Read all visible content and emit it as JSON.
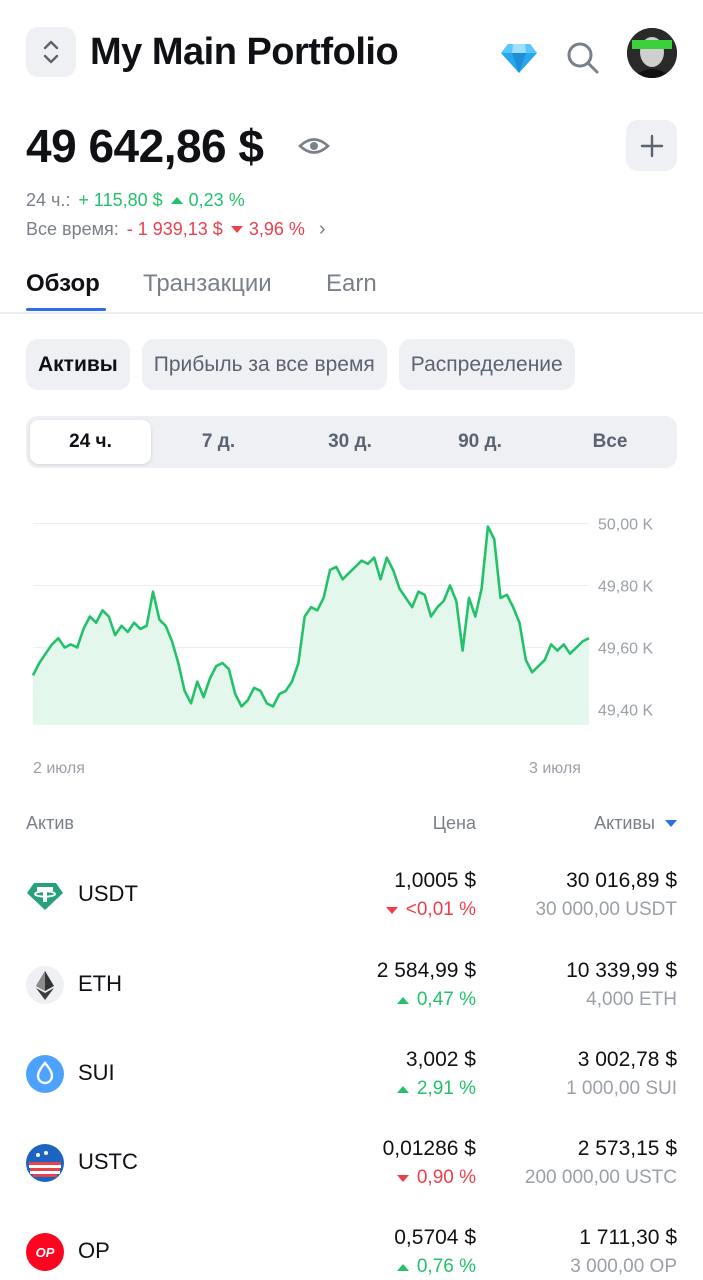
{
  "header": {
    "title": "My Main Portfolio",
    "icons": [
      "switch-portfolio-icon",
      "diamond-icon",
      "search-icon",
      "avatar"
    ]
  },
  "balance": {
    "total": "49 642,86 $",
    "pnl_24h_label": "24 ч.:",
    "pnl_24h_value": "+ 115,80 $",
    "pnl_24h_pct": "0,23 %",
    "pnl_all_label": "Все время:",
    "pnl_all_value": "- 1 939,13 $",
    "pnl_all_pct": "3,96 %"
  },
  "tabs": [
    "Обзор",
    "Транзакции",
    "Earn"
  ],
  "chips": [
    "Активы",
    "Прибыль за все время",
    "Распределение"
  ],
  "periods": [
    "24 ч.",
    "7 д.",
    "30 д.",
    "90 д.",
    "Все"
  ],
  "chart_data": {
    "type": "area",
    "x_labels": [
      "2 июля",
      "3 июля"
    ],
    "y_ticks": [
      "50,00 K",
      "49,80 K",
      "49,60 K",
      "49,40 K"
    ],
    "ylim": [
      49.35,
      50.05
    ],
    "y_unit": "K",
    "values": [
      49.51,
      49.55,
      49.58,
      49.61,
      49.63,
      49.6,
      49.61,
      49.6,
      49.66,
      49.7,
      49.68,
      49.72,
      49.7,
      49.64,
      49.67,
      49.65,
      49.68,
      49.66,
      49.67,
      49.78,
      49.69,
      49.67,
      49.62,
      49.55,
      49.46,
      49.42,
      49.49,
      49.44,
      49.5,
      49.54,
      49.55,
      49.53,
      49.45,
      49.41,
      49.43,
      49.47,
      49.46,
      49.42,
      49.41,
      49.45,
      49.46,
      49.49,
      49.55,
      49.7,
      49.73,
      49.72,
      49.76,
      49.85,
      49.86,
      49.82,
      49.84,
      49.86,
      49.88,
      49.87,
      49.89,
      49.82,
      49.89,
      49.85,
      49.79,
      49.76,
      49.73,
      49.78,
      49.77,
      49.7,
      49.73,
      49.75,
      49.8,
      49.75,
      49.59,
      49.76,
      49.7,
      49.79,
      49.99,
      49.95,
      49.76,
      49.77,
      49.73,
      49.68,
      49.56,
      49.52,
      49.54,
      49.56,
      49.61,
      49.59,
      49.61,
      49.58,
      49.6,
      49.62,
      49.63
    ],
    "color": "#23c26a",
    "fill": "#e4f7ec"
  },
  "table": {
    "headers": {
      "asset": "Актив",
      "price": "Цена",
      "holdings": "Активы"
    },
    "rows": [
      {
        "symbol": "USDT",
        "price": "1,0005 $",
        "change": "<0,01 %",
        "dir": "down",
        "value": "30 016,89 $",
        "amount": "30 000,00  USDT",
        "icon": "tether-icon"
      },
      {
        "symbol": "ETH",
        "price": "2 584,99 $",
        "change": "0,47 %",
        "dir": "up",
        "value": "10 339,99 $",
        "amount": "4,000  ETH",
        "icon": "ethereum-icon"
      },
      {
        "symbol": "SUI",
        "price": "3,002 $",
        "change": "2,91 %",
        "dir": "up",
        "value": "3 002,78 $",
        "amount": "1 000,00  SUI",
        "icon": "sui-icon"
      },
      {
        "symbol": "USTC",
        "price": "0,01286 $",
        "change": "0,90 %",
        "dir": "down",
        "value": "2 573,15 $",
        "amount": "200 000,00  USTC",
        "icon": "ustc-icon"
      },
      {
        "symbol": "OP",
        "price": "0,5704 $",
        "change": "0,76 %",
        "dir": "up",
        "value": "1 711,30 $",
        "amount": "3 000,00  OP",
        "icon": "optimism-icon",
        "icon_text": "OP"
      }
    ]
  }
}
